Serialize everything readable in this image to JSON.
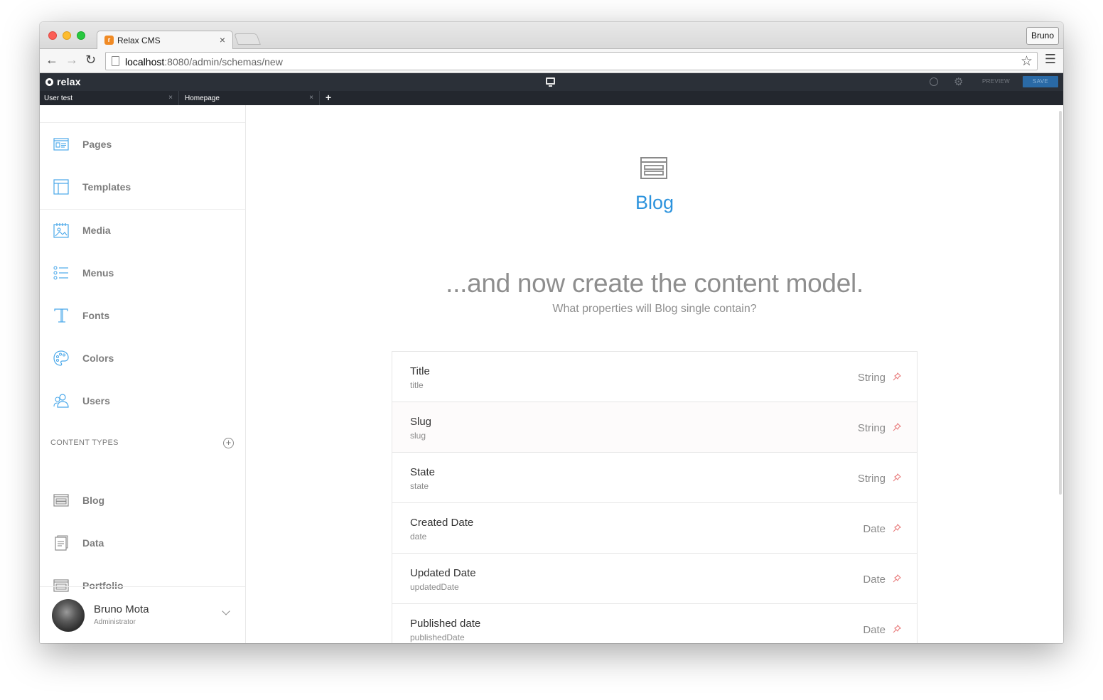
{
  "browser": {
    "tab_title": "Relax CMS",
    "tab_close": "×",
    "profile": "Bruno",
    "url_host": "localhost",
    "url_path": ":8080/admin/schemas/new"
  },
  "appbar": {
    "logo": "relax",
    "preview_label": "PREVIEW",
    "save_label": "SAVE"
  },
  "page_tabs": [
    {
      "label": "User test",
      "close": "×"
    },
    {
      "label": "Homepage",
      "close": "×"
    }
  ],
  "page_tab_add": "+",
  "sidebar": {
    "items": [
      {
        "label": "Pages",
        "icon": "pages-icon"
      },
      {
        "label": "Templates",
        "icon": "templates-icon"
      },
      {
        "label": "Media",
        "icon": "media-icon"
      },
      {
        "label": "Menus",
        "icon": "menus-icon"
      },
      {
        "label": "Fonts",
        "icon": "fonts-icon"
      },
      {
        "label": "Colors",
        "icon": "colors-icon"
      },
      {
        "label": "Users",
        "icon": "users-icon"
      }
    ],
    "section_title": "CONTENT TYPES",
    "content_types": [
      {
        "label": "Blog",
        "icon": "schema-icon"
      },
      {
        "label": "Data",
        "icon": "document-icon"
      },
      {
        "label": "Portfolio",
        "icon": "schema-icon"
      }
    ],
    "user": {
      "name": "Bruno Mota",
      "role": "Administrator"
    }
  },
  "main": {
    "schema_name": "Blog",
    "headline": "...and now create the content model.",
    "subhead": "What properties will Blog single contain?",
    "properties": [
      {
        "title": "Title",
        "key": "title",
        "type": "String"
      },
      {
        "title": "Slug",
        "key": "slug",
        "type": "String"
      },
      {
        "title": "State",
        "key": "state",
        "type": "String"
      },
      {
        "title": "Created Date",
        "key": "date",
        "type": "Date"
      },
      {
        "title": "Updated Date",
        "key": "updatedDate",
        "type": "Date"
      },
      {
        "title": "Published date",
        "key": "publishedDate",
        "type": "Date"
      }
    ]
  },
  "colors": {
    "accent": "#2c93dd",
    "sidebar_icon": "#4aa8ea",
    "pin": "#e87a7a",
    "appbar": "#2b3038"
  }
}
